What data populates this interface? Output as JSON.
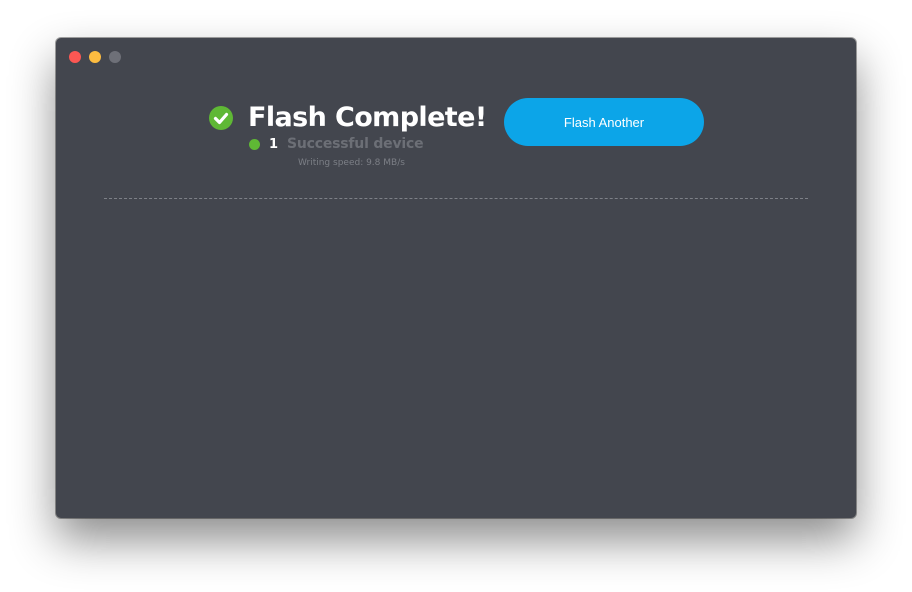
{
  "window": {
    "controls": [
      "close",
      "minimize",
      "zoom"
    ],
    "colors": {
      "background": "#43464e",
      "close": "#fc5753",
      "minimize": "#fdbc40",
      "zoom": "#6e7078"
    }
  },
  "status": {
    "icon": "check-circle-icon",
    "title": "Flash Complete!",
    "success_count": "1",
    "success_label": "Successful device",
    "writing_speed": "Writing speed: 9.8 MB/s",
    "success_color": "#5fb835"
  },
  "actions": {
    "flash_another_label": "Flash Another",
    "accent_color": "#0ca5e8"
  }
}
